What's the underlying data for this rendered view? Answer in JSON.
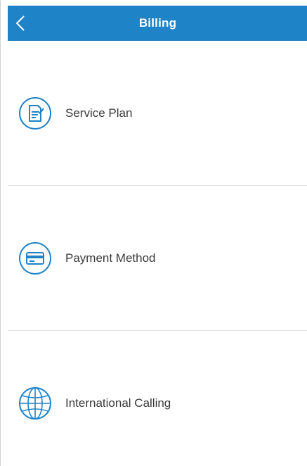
{
  "header": {
    "title": "Billing"
  },
  "colors": {
    "header_bg": "#1f83c7",
    "accent": "#1f83c7",
    "text": "#3a3a3a",
    "divider": "#e3e5e7"
  },
  "menu": {
    "items": [
      {
        "label": "Service Plan",
        "icon": "document-icon"
      },
      {
        "label": "Payment Method",
        "icon": "credit-card-icon"
      },
      {
        "label": "International Calling",
        "icon": "globe-icon"
      }
    ]
  }
}
